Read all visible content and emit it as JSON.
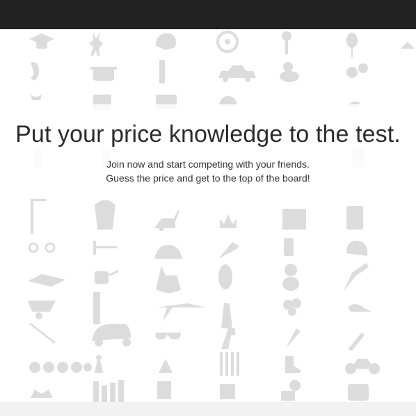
{
  "header": {
    "bg_color": "#222222"
  },
  "hero": {
    "headline": "Put your price knowledge to the test.",
    "line1": "Join now and start competing with your friends.",
    "line2": "Guess the price and get to the top of the board!"
  },
  "pattern": {
    "icon_color": "#dcdcdc",
    "icons": [
      "graduation-cap-icon",
      "deer-icon",
      "helmet-icon",
      "wheel-icon",
      "key-icon",
      "balloon-icon",
      "hanger-icon",
      "hearing-aid-icon",
      "cooking-pot-icon",
      "spark-plug-icon",
      "vintage-car-icon",
      "rubber-duck-icon",
      "wheels-icon",
      "bikini-icon",
      "pot-icon",
      "toaster-icon",
      "hat-icon",
      "guitar-icon",
      "lamp-icon",
      "toy-figure-icon",
      "bottle-icon",
      "lamp-icon",
      "family-figures-icon",
      "clothes-rack-icon",
      "jacket-icon",
      "lawn-mower-icon",
      "crown-icon",
      "knife-block-icon",
      "speaker-icon",
      "handcuffs-icon",
      "corkscrew-icon",
      "baby-walker-icon",
      "drafting-lamp-icon",
      "lantern-icon",
      "football-helmet-icon",
      "bed-icon",
      "watering-can-icon",
      "rocking-chair-icon",
      "mirror-icon",
      "teddy-bear-icon",
      "telescope-icon",
      "wheelbarrow-icon",
      "pendulum-icon",
      "plane-icon",
      "lighthouse-icon",
      "balloons-icon",
      "snail-icon",
      "skis-icon",
      "scooter-icon",
      "sunglasses-icon",
      "drill-icon",
      "bouquet-icon",
      "skate-icon",
      "ring-set-icon",
      "chess-pawn-icon",
      "lamp-icon",
      "pens-icon",
      "boot-icon",
      "motorcycle-icon",
      "climbing-gear-icon",
      "bottles-icon",
      "chair-icon",
      "pills-icon",
      "bag-icon",
      "hot-air-balloon-icon"
    ]
  }
}
